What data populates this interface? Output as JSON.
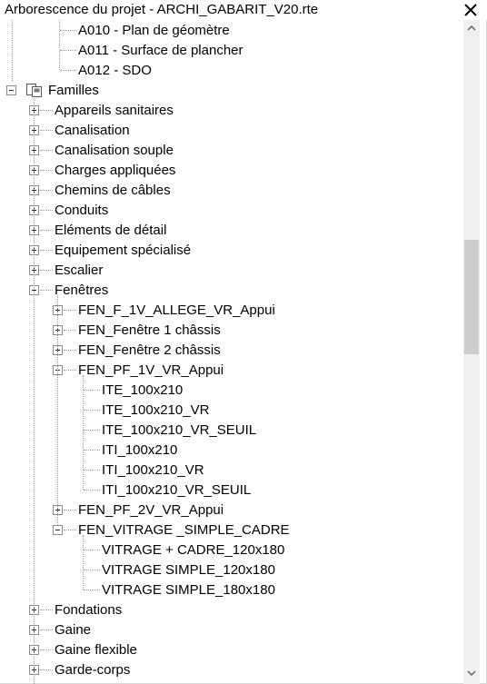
{
  "window": {
    "title": "Arborescence du projet - ARCHI_GABARIT_V20.rte",
    "close_icon": "close-icon"
  },
  "tree": {
    "sheets": [
      {
        "label": "A010 - Plan de géomètre"
      },
      {
        "label": "A011 - Surface de plancher"
      },
      {
        "label": "A012 - SDO"
      }
    ],
    "families": {
      "label": "Familles",
      "icon": "families-icon",
      "expanded": true,
      "categories": [
        {
          "label": "Appareils sanitaires",
          "expanded": false
        },
        {
          "label": "Canalisation",
          "expanded": false
        },
        {
          "label": "Canalisation souple",
          "expanded": false
        },
        {
          "label": "Charges appliquées",
          "expanded": false
        },
        {
          "label": "Chemins de câbles",
          "expanded": false
        },
        {
          "label": "Conduits",
          "expanded": false
        },
        {
          "label": "Eléments de détail",
          "expanded": false
        },
        {
          "label": "Equipement spécialisé",
          "expanded": false
        },
        {
          "label": "Escalier",
          "expanded": false
        },
        {
          "label": "Fenêtres",
          "expanded": true,
          "families": [
            {
              "label": "FEN_F_1V_ALLEGE_VR_Appui",
              "expanded": false,
              "types": []
            },
            {
              "label": "FEN_Fenêtre 1 châssis",
              "expanded": false,
              "types": []
            },
            {
              "label": "FEN_Fenêtre 2 châssis",
              "expanded": false,
              "types": []
            },
            {
              "label": "FEN_PF_1V_VR_Appui",
              "expanded": true,
              "types": [
                {
                  "label": "ITE_100x210"
                },
                {
                  "label": "ITE_100x210_VR"
                },
                {
                  "label": "ITE_100x210_VR_SEUIL"
                },
                {
                  "label": "ITI_100x210"
                },
                {
                  "label": "ITI_100x210_VR"
                },
                {
                  "label": "ITI_100x210_VR_SEUIL"
                }
              ]
            },
            {
              "label": "FEN_PF_2V_VR_Appui",
              "expanded": false,
              "types": []
            },
            {
              "label": "FEN_VITRAGE _SIMPLE_CADRE",
              "expanded": true,
              "types": [
                {
                  "label": "VITRAGE + CADRE_120x180"
                },
                {
                  "label": "VITRAGE SIMPLE_120x180"
                },
                {
                  "label": "VITRAGE SIMPLE_180x180"
                }
              ]
            }
          ]
        },
        {
          "label": "Fondations",
          "expanded": false
        },
        {
          "label": "Gaine",
          "expanded": false
        },
        {
          "label": "Gaine flexible",
          "expanded": false
        },
        {
          "label": "Garde-corps",
          "expanded": false
        }
      ]
    }
  },
  "scrollbar": {
    "up_icon": "chevron-up-icon",
    "down_icon": "chevron-down-icon",
    "position_fraction": 0.33
  }
}
